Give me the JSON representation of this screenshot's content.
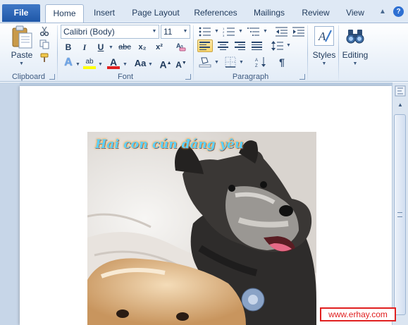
{
  "tabs": {
    "file": "File",
    "items": [
      "Home",
      "Insert",
      "Page Layout",
      "References",
      "Mailings",
      "Review",
      "View"
    ],
    "active": "Home",
    "help": "?"
  },
  "clipboard": {
    "paste_label": "Paste",
    "group_label": "Clipboard"
  },
  "font": {
    "family": "Calibri (Body)",
    "size": "11",
    "bold": "B",
    "italic": "I",
    "underline": "U",
    "strike": "abc",
    "subscript": "x₂",
    "superscript": "x²",
    "grow": "A",
    "shrink": "A",
    "change_case": "Aa",
    "font_color": "A",
    "highlight": "ab",
    "text_effects": "A",
    "group_label": "Font"
  },
  "paragraph": {
    "group_label": "Paragraph",
    "show_marks": "¶"
  },
  "styles": {
    "label": "Styles"
  },
  "editing": {
    "label": "Editing"
  },
  "document": {
    "caption": "Hai con cún đáng yêu"
  },
  "watermark": "www.erhay.com",
  "colors": {
    "file_tab": "#2a62b4",
    "ribbon_bg": "#e3ecf7",
    "highlight_yellow": "#ffff00",
    "font_color_red": "#e02020",
    "selected_button": "#fbd66c",
    "doc_background": "#b8cbe1",
    "watermark_red": "#e02020"
  }
}
